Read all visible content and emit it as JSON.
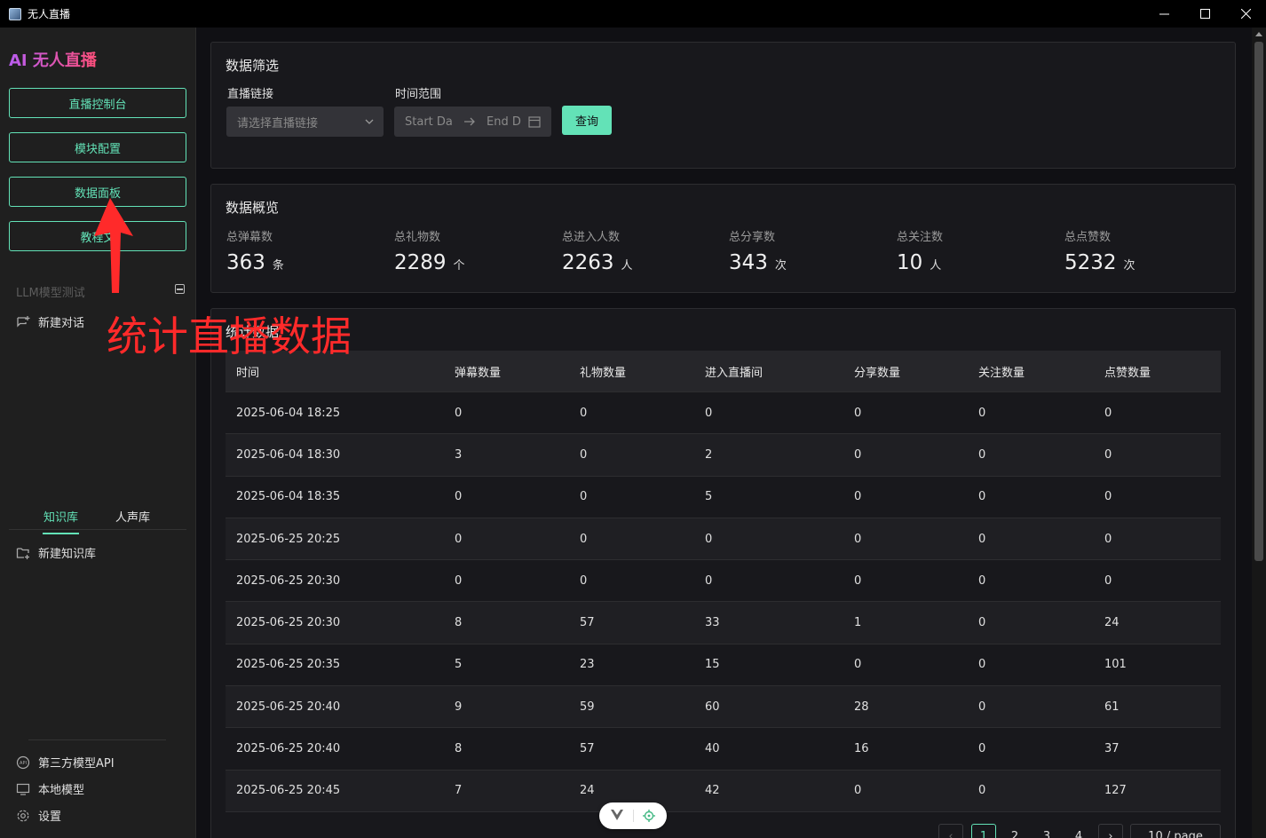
{
  "window": {
    "title": "无人直播"
  },
  "sidebar": {
    "brand": "AI 无人直播",
    "nav": [
      {
        "label": "直播控制台"
      },
      {
        "label": "模块配置"
      },
      {
        "label": "数据面板"
      },
      {
        "label": "教程文"
      }
    ],
    "llm_section_title": "LLM模型测试",
    "new_chat": "新建对话",
    "tabs": [
      {
        "label": "知识库",
        "active": true
      },
      {
        "label": "人声库",
        "active": false
      }
    ],
    "new_kb": "新建知识库",
    "bottom": [
      {
        "label": "第三方模型API",
        "icon": "api-icon"
      },
      {
        "label": "本地模型",
        "icon": "monitor-icon"
      },
      {
        "label": "设置",
        "icon": "gear-icon"
      }
    ]
  },
  "filter": {
    "title": "数据筛选",
    "link_label": "直播链接",
    "link_placeholder": "请选择直播链接",
    "time_label": "时间范围",
    "start_placeholder": "Start Da",
    "end_placeholder": "End D",
    "query_button": "查询"
  },
  "overview": {
    "title": "数据概览",
    "stats": [
      {
        "label": "总弹幕数",
        "value": "363",
        "unit": "条"
      },
      {
        "label": "总礼物数",
        "value": "2289",
        "unit": "个"
      },
      {
        "label": "总进入人数",
        "value": "2263",
        "unit": "人"
      },
      {
        "label": "总分享数",
        "value": "343",
        "unit": "次"
      },
      {
        "label": "总关注数",
        "value": "10",
        "unit": "人"
      },
      {
        "label": "总点赞数",
        "value": "5232",
        "unit": "次"
      }
    ]
  },
  "stats_table": {
    "title": "统计数据",
    "columns": [
      "时间",
      "弹幕数量",
      "礼物数量",
      "进入直播间",
      "分享数量",
      "关注数量",
      "点赞数量"
    ],
    "rows": [
      [
        "2025-06-04 18:25",
        "0",
        "0",
        "0",
        "0",
        "0",
        "0"
      ],
      [
        "2025-06-04 18:30",
        "3",
        "0",
        "2",
        "0",
        "0",
        "0"
      ],
      [
        "2025-06-04 18:35",
        "0",
        "0",
        "5",
        "0",
        "0",
        "0"
      ],
      [
        "2025-06-25 20:25",
        "0",
        "0",
        "0",
        "0",
        "0",
        "0"
      ],
      [
        "2025-06-25 20:30",
        "0",
        "0",
        "0",
        "0",
        "0",
        "0"
      ],
      [
        "2025-06-25 20:30",
        "8",
        "57",
        "33",
        "1",
        "0",
        "24"
      ],
      [
        "2025-06-25 20:35",
        "5",
        "23",
        "15",
        "0",
        "0",
        "101"
      ],
      [
        "2025-06-25 20:40",
        "9",
        "59",
        "60",
        "28",
        "0",
        "61"
      ],
      [
        "2025-06-25 20:40",
        "8",
        "57",
        "40",
        "16",
        "0",
        "37"
      ],
      [
        "2025-06-25 20:45",
        "7",
        "24",
        "42",
        "0",
        "0",
        "127"
      ]
    ]
  },
  "pagination": {
    "pages": [
      "1",
      "2",
      "3",
      "4"
    ],
    "current": "1",
    "page_size": "10 / page"
  },
  "annotation": {
    "text": "统计直播数据",
    "color": "#ff2a2a"
  },
  "colors": {
    "accent": "#63e2b7",
    "background": "#101014",
    "card": "#18181c"
  }
}
